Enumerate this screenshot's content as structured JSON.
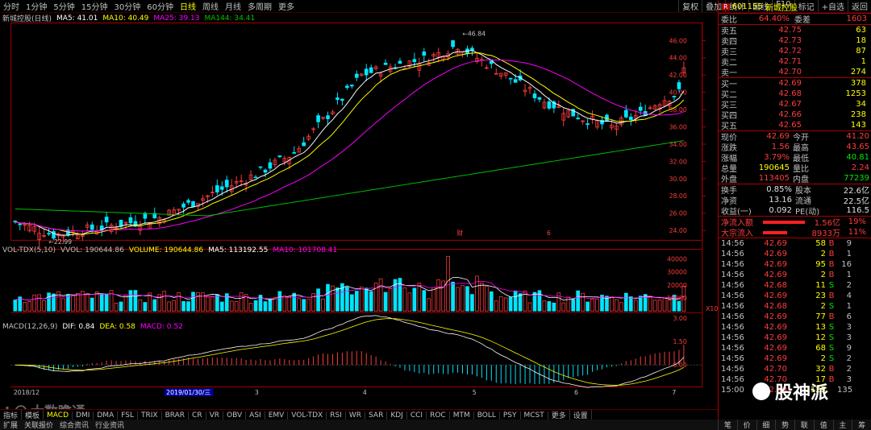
{
  "toolbar": {
    "periods": [
      "分时",
      "1分钟",
      "5分钟",
      "15分钟",
      "30分钟",
      "60分钟",
      "日线",
      "周线",
      "月线",
      "多周期",
      "更多"
    ],
    "active_period": "日线",
    "right_buttons": [
      "复权",
      "叠加",
      "统计",
      "画线",
      "F10",
      "标记",
      "+自选",
      "返回"
    ]
  },
  "main_chart": {
    "title": "新城控股(日线)",
    "ma5": "MA5: 41.01",
    "ma10": "MA10: 40.49",
    "ma25": "MA25: 39.13",
    "ma144": "MA144: 34.41",
    "high_marker": "46.84",
    "low_marker": "22.99",
    "event_markers": [
      "财",
      "6"
    ],
    "y_ticks": [
      "46.00",
      "44.00",
      "42.00",
      "40.00",
      "38.00",
      "36.00",
      "34.00",
      "32.00",
      "30.00",
      "28.00",
      "26.00",
      "24.00"
    ]
  },
  "volume_chart": {
    "title": "VOL-TDX(5,10)",
    "vvol": "VVOL: 190644.86",
    "volume": "VOLUME: 190644.86",
    "ma5": "MA5: 113192.55",
    "ma10": "MA10: 101708.41",
    "y_ticks": [
      "40000",
      "30000",
      "20000",
      "10000"
    ],
    "unit": "X10"
  },
  "macd_chart": {
    "title": "MACD(12,26,9)",
    "dif": "DIF: 0.84",
    "dea": "DEA: 0.58",
    "macd": "MACD: 0.52",
    "y_ticks": [
      "3.00",
      "1.50",
      "0.00"
    ]
  },
  "x_axis": {
    "labels": [
      "2018/12",
      "3",
      "4",
      "5",
      "6",
      "7"
    ],
    "cursor_date": "2019/01/30/三"
  },
  "indicator_tabs": [
    "指标",
    "模板",
    "MACD",
    "DMI",
    "DMA",
    "FSL",
    "TRIX",
    "BRAR",
    "CR",
    "VR",
    "OBV",
    "ASI",
    "EMV",
    "VOL-TDX",
    "RSI",
    "WR",
    "SAR",
    "KDJ",
    "CCI",
    "ROC",
    "MTM",
    "BOLL",
    "PSY",
    "MCST",
    "更多",
    "设置"
  ],
  "status_tabs": [
    "扩展",
    "关联报价",
    "综合资讯",
    "行业资讯"
  ],
  "watermark_left": "大数瞻通",
  "watermark_right": "股神派",
  "quote": {
    "code": "601155",
    "name": "新城控股",
    "weibi_label": "委比",
    "weibi": "64.40%",
    "weicha_label": "委差",
    "weicha": "1603",
    "sells": [
      {
        "label": "卖五",
        "price": "42.75",
        "vol": "63"
      },
      {
        "label": "卖四",
        "price": "42.73",
        "vol": "18"
      },
      {
        "label": "卖三",
        "price": "42.72",
        "vol": "87"
      },
      {
        "label": "卖二",
        "price": "42.71",
        "vol": "1"
      },
      {
        "label": "卖一",
        "price": "42.70",
        "vol": "274"
      }
    ],
    "buys": [
      {
        "label": "买一",
        "price": "42.69",
        "vol": "378"
      },
      {
        "label": "买二",
        "price": "42.68",
        "vol": "1253"
      },
      {
        "label": "买三",
        "price": "42.67",
        "vol": "34"
      },
      {
        "label": "买四",
        "price": "42.66",
        "vol": "238"
      },
      {
        "label": "买五",
        "price": "42.65",
        "vol": "143"
      }
    ],
    "stats": [
      {
        "l1": "现价",
        "v1": "42.69",
        "l2": "今开",
        "v2": "41.20",
        "c1": "red",
        "c2": "red"
      },
      {
        "l1": "涨跌",
        "v1": "1.56",
        "l2": "最高",
        "v2": "43.65",
        "c1": "red",
        "c2": "red"
      },
      {
        "l1": "涨幅",
        "v1": "3.79%",
        "l2": "最低",
        "v2": "40.81",
        "c1": "red",
        "c2": "green"
      },
      {
        "l1": "总量",
        "v1": "190645",
        "l2": "量比",
        "v2": "2.24",
        "c1": "yellow",
        "c2": "red"
      },
      {
        "l1": "外盘",
        "v1": "113405",
        "l2": "内盘",
        "v2": "77239",
        "c1": "red",
        "c2": "green"
      }
    ],
    "stats2": [
      {
        "l1": "换手",
        "v1": "0.85%",
        "l2": "股本",
        "v2": "22.6亿"
      },
      {
        "l1": "净资",
        "v1": "13.16",
        "l2": "流通",
        "v2": "22.5亿"
      },
      {
        "l1": "收益(一)",
        "v1": "0.092",
        "l2": "PE(动)",
        "v2": "116.5"
      }
    ],
    "flows": [
      {
        "label": "净流入额",
        "val": "1.56亿",
        "pct": "19%"
      },
      {
        "label": "大宗流入",
        "val": "8933万",
        "pct": "11%"
      }
    ],
    "trades": [
      {
        "t": "14:56",
        "p": "42.69",
        "v": "58",
        "d": "B",
        "n": "9"
      },
      {
        "t": "14:56",
        "p": "42.69",
        "v": "2",
        "d": "B",
        "n": "1"
      },
      {
        "t": "14:56",
        "p": "42.69",
        "v": "95",
        "d": "B",
        "n": "16"
      },
      {
        "t": "14:56",
        "p": "42.69",
        "v": "2",
        "d": "B",
        "n": "1"
      },
      {
        "t": "14:56",
        "p": "42.68",
        "v": "11",
        "d": "S",
        "n": "2"
      },
      {
        "t": "14:56",
        "p": "42.69",
        "v": "23",
        "d": "B",
        "n": "4"
      },
      {
        "t": "14:56",
        "p": "42.68",
        "v": "2",
        "d": "S",
        "n": "1"
      },
      {
        "t": "14:56",
        "p": "42.69",
        "v": "77",
        "d": "B",
        "n": "6"
      },
      {
        "t": "14:56",
        "p": "42.69",
        "v": "13",
        "d": "S",
        "n": "3"
      },
      {
        "t": "14:56",
        "p": "42.69",
        "v": "12",
        "d": "S",
        "n": "3"
      },
      {
        "t": "14:56",
        "p": "42.69",
        "v": "68",
        "d": "S",
        "n": "9"
      },
      {
        "t": "14:56",
        "p": "42.69",
        "v": "2",
        "d": "S",
        "n": "2"
      },
      {
        "t": "14:56",
        "p": "42.70",
        "v": "32",
        "d": "B",
        "n": "2"
      },
      {
        "t": "14:56",
        "p": "42.70",
        "v": "17",
        "d": "B",
        "n": "3"
      },
      {
        "t": "15:00",
        "p": "42.69",
        "v": "1125",
        "d": "",
        "n": "135"
      }
    ],
    "bottom_tabs": [
      "笔",
      "价",
      "细",
      "势",
      "联",
      "值",
      "主",
      "筹"
    ]
  },
  "colors": {
    "up": "#ff3c3c",
    "down": "#00e5ff",
    "ma5": "#ffffff",
    "ma10": "#ffff00",
    "ma25": "#ff00ff",
    "ma144": "#00c000"
  }
}
